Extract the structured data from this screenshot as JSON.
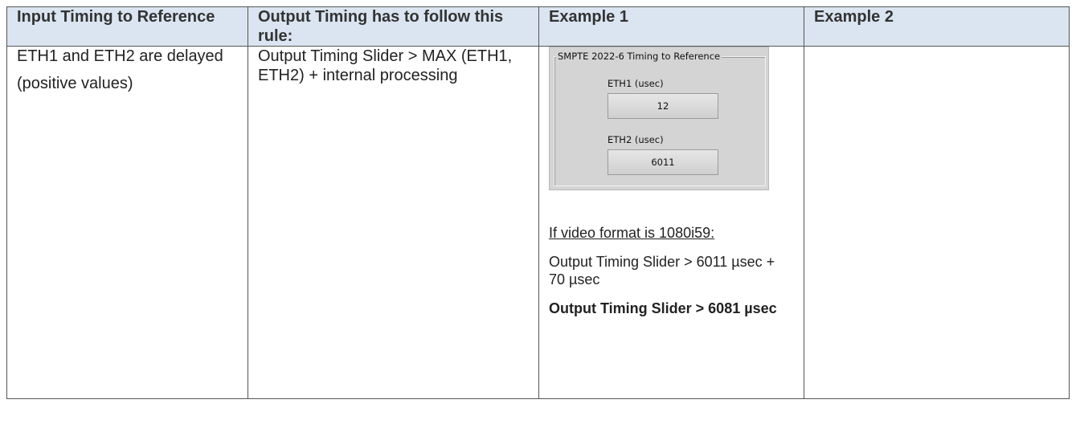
{
  "table": {
    "headers": [
      "Input Timing to Reference",
      "Output Timing has to follow this rule:",
      "Example 1",
      "Example 2"
    ],
    "row": {
      "input": {
        "line1": "ETH1 and ETH2 are delayed",
        "line2": "(positive values)"
      },
      "rule": "Output Timing Slider > MAX (ETH1, ETH2) + internal processing",
      "example1": {
        "panel": {
          "title": "SMPTE 2022-6 Timing to Reference",
          "eth1_label": "ETH1 (usec)",
          "eth1_value": "12",
          "eth2_label": "ETH2 (usec)",
          "eth2_value": "6011"
        },
        "condition": "If video format is 1080i59:",
        "calc": "Output Timing Slider > 6011 µsec + 70 µsec",
        "result": "Output Timing Slider > 6081 µsec"
      },
      "example2": ""
    }
  }
}
